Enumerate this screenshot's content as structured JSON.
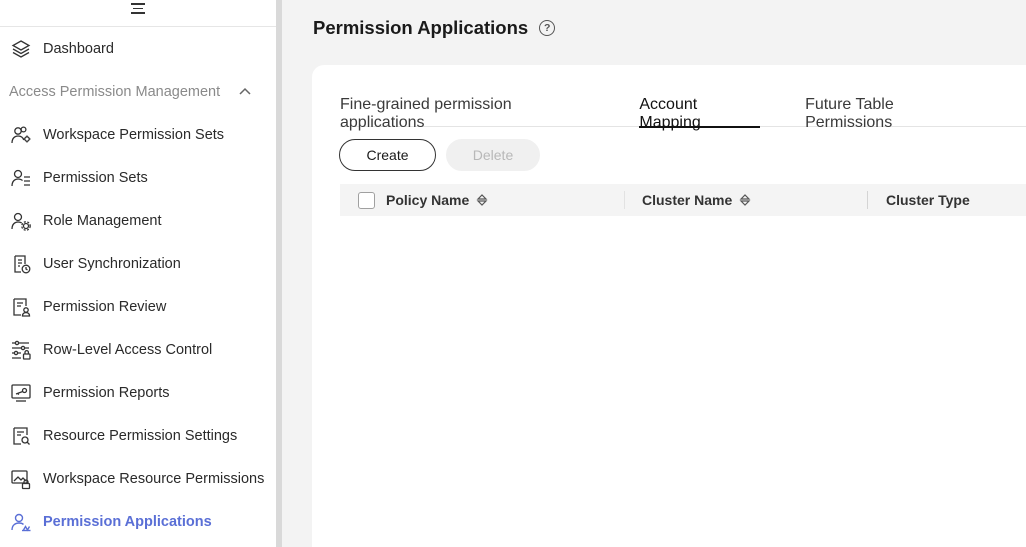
{
  "sidebar": {
    "items": [
      {
        "label": "Dashboard",
        "icon": "layers-icon"
      },
      {
        "label": "Workspace Permission Sets",
        "icon": "user-group-settings-icon"
      },
      {
        "label": "Permission Sets",
        "icon": "user-list-icon"
      },
      {
        "label": "Role Management",
        "icon": "user-gear-icon"
      },
      {
        "label": "User Synchronization",
        "icon": "document-sync-icon"
      },
      {
        "label": "Permission Review",
        "icon": "document-user-icon"
      },
      {
        "label": "Row-Level Access Control",
        "icon": "sliders-lock-icon"
      },
      {
        "label": "Permission Reports",
        "icon": "monitor-key-icon"
      },
      {
        "label": "Resource Permission Settings",
        "icon": "document-search-icon"
      },
      {
        "label": "Workspace Resource Permissions",
        "icon": "image-lock-icon"
      },
      {
        "label": "Permission Applications",
        "icon": "user-apply-icon"
      }
    ],
    "group_label": "Access Permission Management"
  },
  "main": {
    "title": "Permission Applications",
    "help_glyph": "?",
    "tabs": [
      {
        "label": "Fine-grained permission applications"
      },
      {
        "label": "Account Mapping"
      },
      {
        "label": "Future Table Permissions"
      }
    ],
    "active_tab": "Account Mapping",
    "buttons": {
      "create": "Create",
      "delete": "Delete"
    },
    "table": {
      "columns": [
        "Policy Name",
        "Cluster Name",
        "Cluster Type"
      ],
      "rows": []
    }
  },
  "colors": {
    "accent": "#5a6fd6",
    "sidebar_bg": "#ffffff",
    "main_bg": "#f3f3f3",
    "table_head_bg": "#f4f4f4"
  }
}
